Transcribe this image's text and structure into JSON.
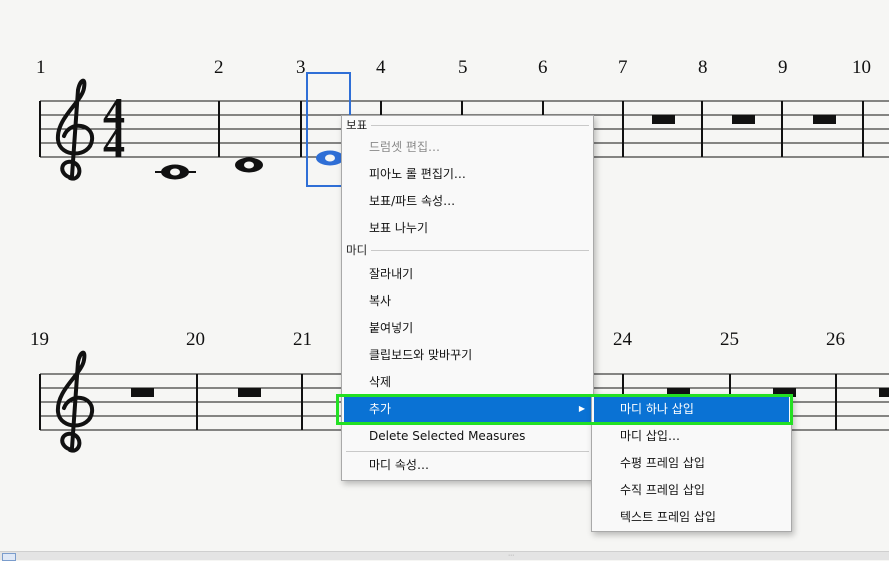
{
  "score": {
    "system1_measure_numbers": [
      "1",
      "2",
      "3",
      "4",
      "5",
      "6",
      "7",
      "8",
      "9",
      "10"
    ],
    "system2_measure_numbers": [
      "19",
      "20",
      "21",
      "24",
      "25",
      "26"
    ],
    "time_signature": {
      "top": "4",
      "bottom": "4"
    },
    "accent_color": "#2f6fd6"
  },
  "context_menu": {
    "section_staff": "보표",
    "drumset_edit": "드럼셋 편집…",
    "piano_roll": "피아노 롤 편집기…",
    "staff_part_props": "보표/파트 속성…",
    "split_staff": "보표 나누기",
    "section_measure": "마디",
    "cut": "잘라내기",
    "copy": "복사",
    "paste": "붙여넣기",
    "swap_clipboard": "클립보드와 맞바꾸기",
    "delete": "삭제",
    "add": "추가",
    "delete_selected_measures": "Delete Selected Measures",
    "measure_props": "마디 속성…"
  },
  "submenu": {
    "insert_one_measure": "마디 하나 삽입",
    "insert_measures": "마디 삽입…",
    "insert_hframe": "수평 프레임 삽입",
    "insert_vframe": "수직 프레임 삽입",
    "insert_text_frame": "텍스트 프레임 삽입"
  },
  "colors": {
    "highlight": "#0a72d4",
    "focus_outline": "#23e023"
  }
}
